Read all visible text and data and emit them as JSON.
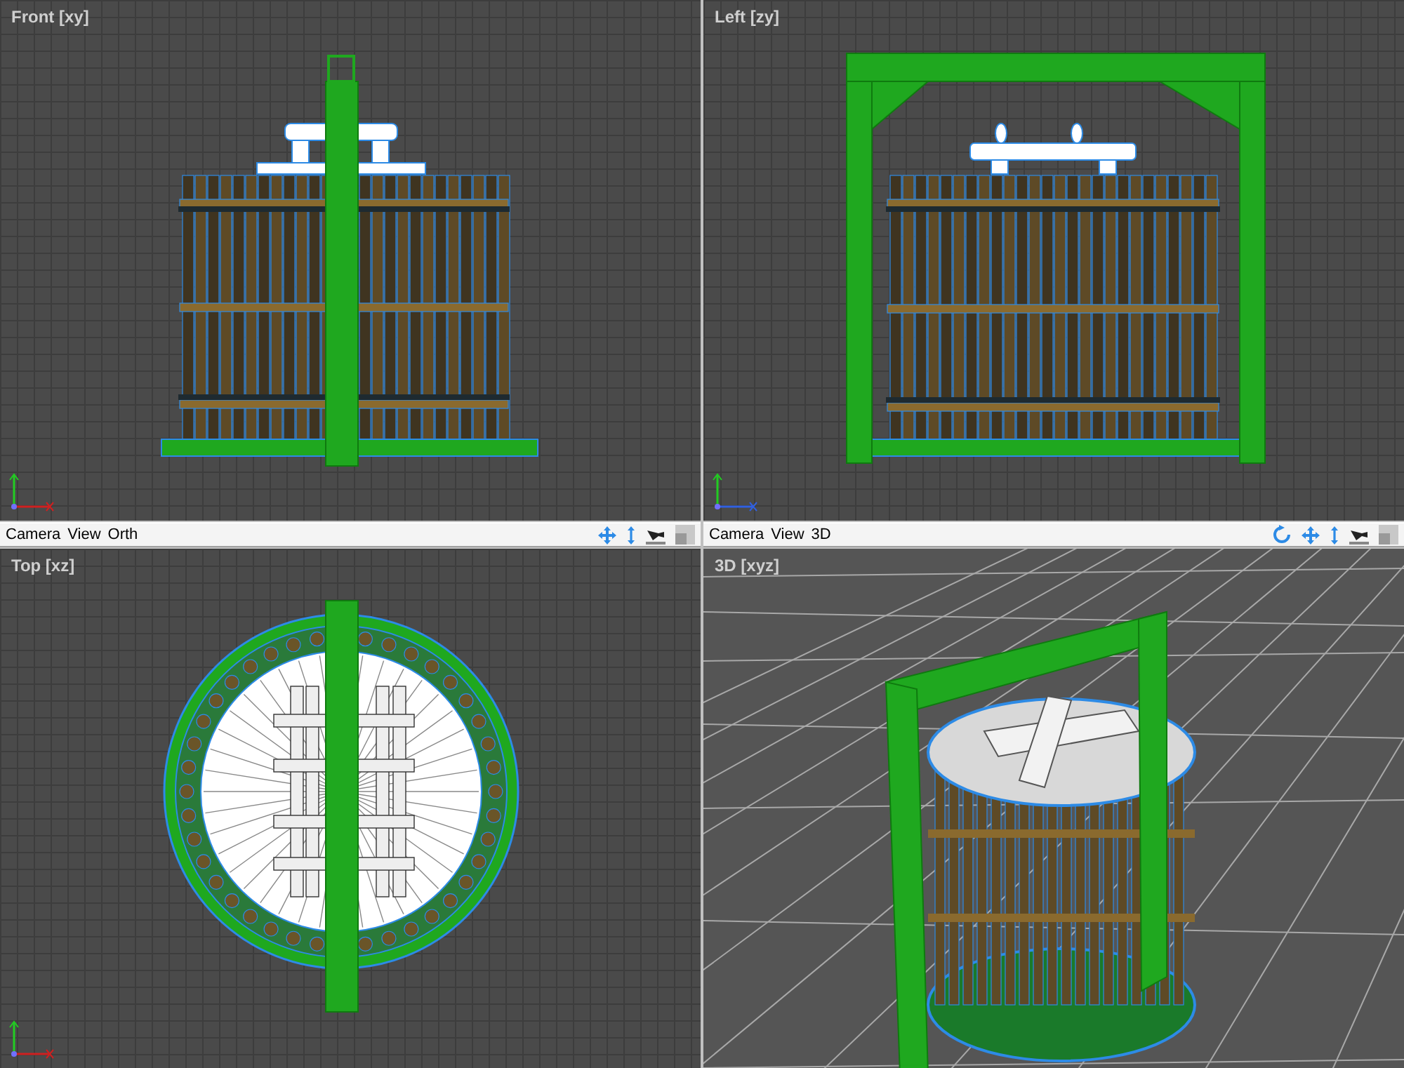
{
  "viewports": [
    {
      "label": "Front [xy]",
      "kind": "front"
    },
    {
      "label": "Left [zy]",
      "kind": "left"
    },
    {
      "label": "Top [xz]",
      "kind": "top"
    },
    {
      "label": "3D [xyz]",
      "kind": "persp"
    }
  ],
  "toolbars": [
    {
      "items": [
        "Camera",
        "View",
        "Orth"
      ],
      "rotate": false
    },
    {
      "items": [
        "Camera",
        "View",
        "3D"
      ],
      "rotate": true
    }
  ]
}
